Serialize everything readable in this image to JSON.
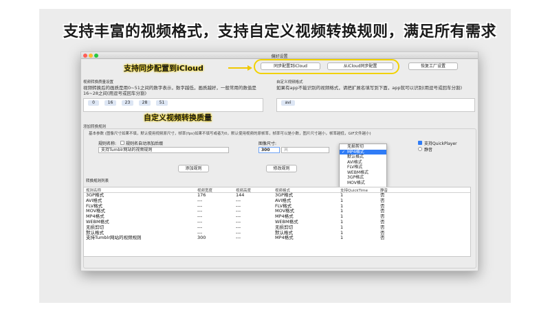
{
  "headline": "支持丰富的视频格式，支持自定义视频转换规则，满足所有需求",
  "window": {
    "title": "偏好设置",
    "traffic_lights": {
      "close": "#fe5f57",
      "minimize": "#febc2e",
      "zoom": "#28c840"
    }
  },
  "callouts": {
    "icloud": "支持同步配置到iCloud",
    "quality": "自定义视频转换质量",
    "highlight_color": "#f2d200"
  },
  "toolbar": {
    "sync_to_icloud": "同步配置到iCloud",
    "sync_from_icloud": "从iCloud同步配置",
    "restore_defaults": "恢复工厂设置"
  },
  "quality": {
    "section_label": "视频转换质量设置",
    "description": "视频转换后的画质是用0~51之间的数字表示，数字越低，画质越好，一般常用的数值是16~28之间(用逗号或回车分割)",
    "values": [
      "0",
      "16",
      "23",
      "28",
      "51"
    ]
  },
  "custom_format": {
    "section_label": "自定义视频格式",
    "description": "如果有app不能识别的视频格式，请把扩展名填写到下面，app就可以识别(用逗号或回车分割)",
    "values": [
      "avi"
    ]
  },
  "add_rule": {
    "section_label": "添加转换规则",
    "hint": "基本参数 (图像尺寸如果不填，默认使用视频原尺寸，帧率(fps)如果不填写或者为0，默认使用视频的原帧率，帧率可以是小数，图片尺寸越小，帧率越低，GIF文件越小)",
    "rule_name_label": "规则名称:",
    "auto_add_label": "规则名自动添加后缀",
    "rule_name_value": "支持Tumblr网站的视频规则",
    "image_size_label": "图像尺寸:",
    "width_value": "300",
    "height_placeholder": "高",
    "quicktime_label": "支持QuickPlayer",
    "mute_label": "静音",
    "add_button": "添加规则",
    "modify_button": "修改规则"
  },
  "format_menu": {
    "options": [
      "无损剪切",
      "MP4格式",
      "默认格式",
      "AVI格式",
      "FLV格式",
      "WEBM格式",
      "3GP格式",
      "MOV格式"
    ],
    "selected": "MP4格式"
  },
  "rules_table": {
    "section_label": "转换规则列表",
    "columns": [
      "规则名称",
      "视频宽度",
      "视频高度",
      "视频格式",
      "支持QuickTime",
      "静音"
    ],
    "rows": [
      [
        "3GP格式",
        "176",
        "144",
        "3GP格式",
        "1",
        "否"
      ],
      [
        "AVI格式",
        "---",
        "---",
        "AVI格式",
        "1",
        "否"
      ],
      [
        "FLV格式",
        "---",
        "---",
        "FLV格式",
        "1",
        "否"
      ],
      [
        "MOV格式",
        "---",
        "---",
        "MOV格式",
        "1",
        "否"
      ],
      [
        "MP4格式",
        "---",
        "---",
        "MP4格式",
        "1",
        "否"
      ],
      [
        "WEBM格式",
        "---",
        "---",
        "WEBM格式",
        "1",
        "否"
      ],
      [
        "无损剪切",
        "---",
        "---",
        "无损剪切",
        "1",
        "否"
      ],
      [
        "默认格式",
        "---",
        "---",
        "默认格式",
        "1",
        "否"
      ],
      [
        "支持Tumblr网站的视频规则",
        "300",
        "---",
        "MP4格式",
        "1",
        "否"
      ]
    ]
  }
}
